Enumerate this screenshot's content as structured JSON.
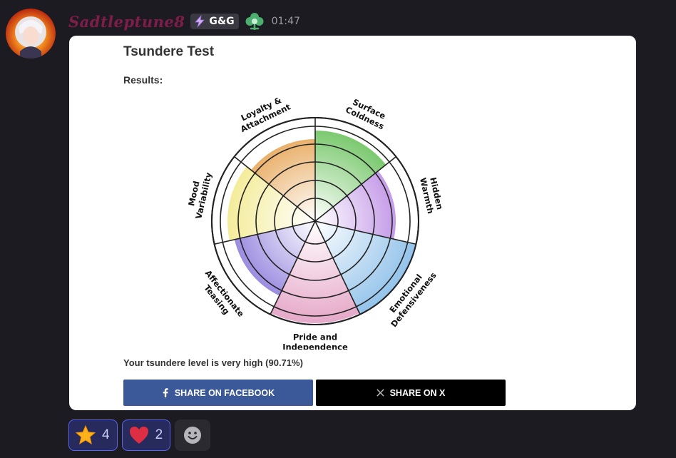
{
  "message": {
    "username": "Sadtleptune8",
    "guild_tag": "G&G",
    "timestamp": "01:47",
    "colors": {
      "username": "#7a1e4a",
      "background": "#1c1b22"
    }
  },
  "card": {
    "title": "Tsundere Test",
    "results_label": "Results:",
    "level_text": "Your tsundere level is very high (90.71%)",
    "buttons": {
      "facebook": "SHARE ON FACEBOOK",
      "x": "SHARE ON X"
    },
    "chart": {
      "categories": [
        {
          "lines": [
            "Surface",
            "Coldness"
          ],
          "color": "#7bc96f"
        },
        {
          "lines": [
            "Hidden",
            "Warmth"
          ],
          "color": "#c59be8"
        },
        {
          "lines": [
            "Emotional",
            "Defensiveness"
          ],
          "color": "#93c3ea"
        },
        {
          "lines": [
            "Pride and",
            "Independence"
          ],
          "color": "#e6a9c9"
        },
        {
          "lines": [
            "Affectionate",
            "Teasing"
          ],
          "color": "#9b8ce0"
        },
        {
          "lines": [
            "Mood",
            "Variability"
          ],
          "color": "#f4ec9a"
        },
        {
          "lines": [
            "Loyalty &",
            "Attachment"
          ],
          "color": "#e9b06a"
        }
      ]
    }
  },
  "reactions": [
    {
      "icon": "star-icon",
      "count": "4"
    },
    {
      "icon": "heart-icon",
      "count": "2"
    }
  ]
}
